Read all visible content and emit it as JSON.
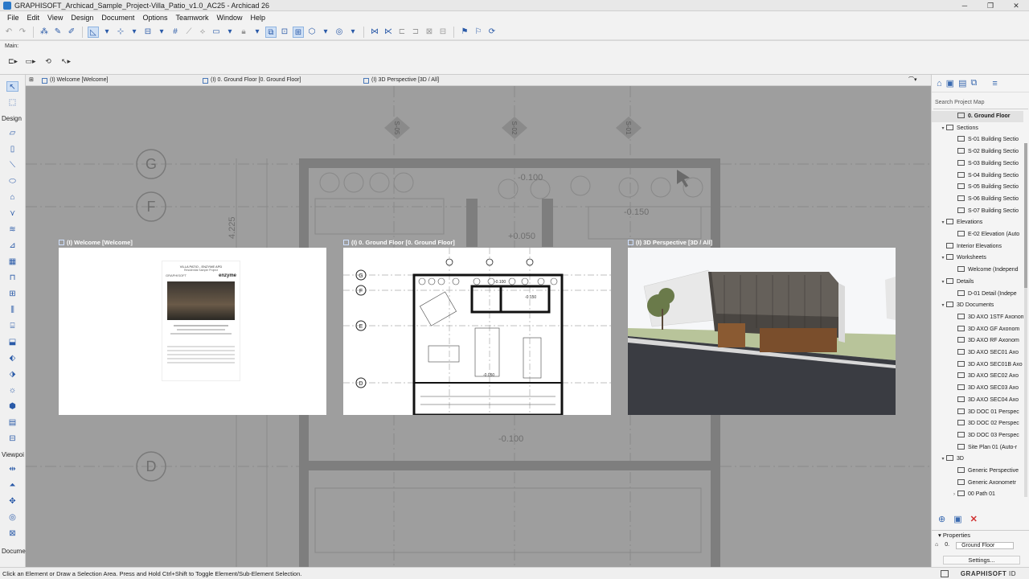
{
  "window": {
    "title": "GRAPHISOFT_Archicad_Sample_Project-Villa_Patio_v1.0_AC25 - Archicad 26",
    "min": "─",
    "max": "❐",
    "close": "✕"
  },
  "menu": [
    "File",
    "Edit",
    "View",
    "Design",
    "Document",
    "Options",
    "Teamwork",
    "Window",
    "Help"
  ],
  "infobox": {
    "label": "Main:"
  },
  "tabs": [
    {
      "label": "(I) Welcome [Welcome]"
    },
    {
      "label": "(I) 0. Ground Floor [0. Ground Floor]"
    },
    {
      "label": "(I) 3D Perspective [3D / All]"
    }
  ],
  "toolbox": {
    "design": "Design",
    "viewpoint": "Viewpoi",
    "document": "Docume"
  },
  "thumbnails": [
    {
      "label": "(I) Welcome [Welcome]",
      "doc_title": "VILLA PATIO - ENZYME APD",
      "doc_subtitle": "Residential Sample Project",
      "brand": "GRAPHISOFT",
      "brand2": "enzyme"
    },
    {
      "label": "(I) 0. Ground Floor [0. Ground Floor]",
      "grid_labels": [
        "G",
        "F",
        "E",
        "D"
      ],
      "levels": [
        "-0.100",
        "-0.150",
        "-0.050"
      ]
    },
    {
      "label": "(I) 3D Perspective [3D / All]"
    }
  ],
  "canvas": {
    "grid_labels": [
      "G",
      "F",
      "D"
    ],
    "section_marks": [
      "S-05",
      "S-02",
      "S-01"
    ],
    "levels": [
      "-0.100",
      "-0.150",
      "+0.050",
      "-0.100"
    ],
    "dim": "4.225"
  },
  "navigator": {
    "search_placeholder": "Search Project Map",
    "tree": [
      {
        "label": "0. Ground Floor",
        "level": 1,
        "highlight": true,
        "twisty": ""
      },
      {
        "label": "Sections",
        "level": 0,
        "twisty": "▾"
      },
      {
        "label": "S-01 Building Sectio",
        "level": 1,
        "twisty": ""
      },
      {
        "label": "S-02 Building Sectio",
        "level": 1,
        "twisty": ""
      },
      {
        "label": "S-03 Building Sectio",
        "level": 1,
        "twisty": ""
      },
      {
        "label": "S-04 Building Sectio",
        "level": 1,
        "twisty": ""
      },
      {
        "label": "S-05 Building Sectio",
        "level": 1,
        "twisty": ""
      },
      {
        "label": "S-06 Building Sectio",
        "level": 1,
        "twisty": ""
      },
      {
        "label": "S-07 Building Sectio",
        "level": 1,
        "twisty": ""
      },
      {
        "label": "Elevations",
        "level": 0,
        "twisty": "▾"
      },
      {
        "label": "E-02 Elevation (Auto",
        "level": 1,
        "twisty": ""
      },
      {
        "label": "Interior Elevations",
        "level": 0,
        "twisty": ""
      },
      {
        "label": "Worksheets",
        "level": 0,
        "twisty": "▾"
      },
      {
        "label": "Welcome (Independ",
        "level": 1,
        "twisty": ""
      },
      {
        "label": "Details",
        "level": 0,
        "twisty": "▾"
      },
      {
        "label": "D-01 Detail (Indepe",
        "level": 1,
        "twisty": ""
      },
      {
        "label": "3D Documents",
        "level": 0,
        "twisty": "▾"
      },
      {
        "label": "3D AXO 1STF Axonom",
        "level": 1,
        "twisty": ""
      },
      {
        "label": "3D AXO GF Axonom",
        "level": 1,
        "twisty": ""
      },
      {
        "label": "3D AXO RF Axonom",
        "level": 1,
        "twisty": ""
      },
      {
        "label": "3D AXO SEC01 Axo",
        "level": 1,
        "twisty": ""
      },
      {
        "label": "3D AXO SEC01B Axo",
        "level": 1,
        "twisty": ""
      },
      {
        "label": "3D AXO SEC02 Axo",
        "level": 1,
        "twisty": ""
      },
      {
        "label": "3D AXO SEC03 Axo",
        "level": 1,
        "twisty": ""
      },
      {
        "label": "3D AXO SEC04 Axo",
        "level": 1,
        "twisty": ""
      },
      {
        "label": "3D DOC 01 Perspec",
        "level": 1,
        "twisty": ""
      },
      {
        "label": "3D DOC 02 Perspec",
        "level": 1,
        "twisty": ""
      },
      {
        "label": "3D DOC 03 Perspec",
        "level": 1,
        "twisty": ""
      },
      {
        "label": "Site Plan 01 (Auto-r",
        "level": 1,
        "twisty": ""
      },
      {
        "label": "3D",
        "level": 0,
        "twisty": "▾"
      },
      {
        "label": "Generic Perspective",
        "level": 1,
        "twisty": ""
      },
      {
        "label": "Generic Axonometr",
        "level": 1,
        "twisty": ""
      },
      {
        "label": "00 Path 01",
        "level": 1,
        "twisty": "›"
      }
    ],
    "properties_title": "Properties",
    "prop_id": "0.",
    "prop_value": "Ground Floor",
    "settings": "Settings..."
  },
  "statusbar": {
    "text": "Click an Element or Draw a Selection Area. Press and Hold Ctrl+Shift to Toggle Element/Sub-Element Selection.",
    "brand": "GRAPHISOFT",
    "brand_suffix": "ID"
  }
}
